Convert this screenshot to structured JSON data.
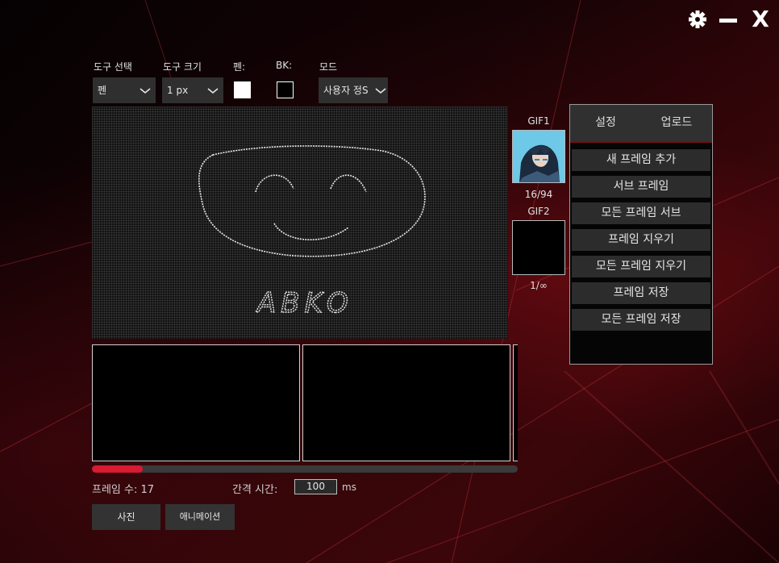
{
  "window": {
    "settings_icon": "gear-icon",
    "minimize_icon": "minimize-icon",
    "close_label": "X"
  },
  "toolbar": {
    "tool_select_label": "도구 선택",
    "tool_size_label": "도구 크기",
    "pen_color_label": "펜:",
    "bk_color_label": "BK:",
    "mode_label": "모드",
    "tool_select_value": "펜",
    "tool_size_value": "1 px",
    "mode_value": "사용자 정S",
    "pen_color": "#ffffff",
    "bk_color": "#000000"
  },
  "canvas": {
    "drawn_text": "ABKO"
  },
  "gifs": {
    "gif1_label": "GIF1",
    "gif1_counter": "16/94",
    "gif2_label": "GIF2",
    "gif2_counter": "1/∞"
  },
  "panel": {
    "tabs": [
      {
        "label": "설정"
      },
      {
        "label": "업로드"
      }
    ],
    "buttons": [
      {
        "label": "새 프레임 추가"
      },
      {
        "label": "서브 프레임"
      },
      {
        "label": "모든 프레임 서브"
      },
      {
        "label": "프레임 지우기"
      },
      {
        "label": "모든 프레임 지우기"
      },
      {
        "label": "프레임 저장"
      },
      {
        "label": "모든 프레임 저장"
      }
    ]
  },
  "timeline": {
    "progress_fraction": 0.12,
    "accent_color": "#d81a32"
  },
  "footer": {
    "frame_count_label": "프레임 수: 17",
    "interval_label": "간격 시간:",
    "interval_value": "100",
    "interval_unit": "ms",
    "photo_button": "사진",
    "animation_button": "애니메이션"
  }
}
